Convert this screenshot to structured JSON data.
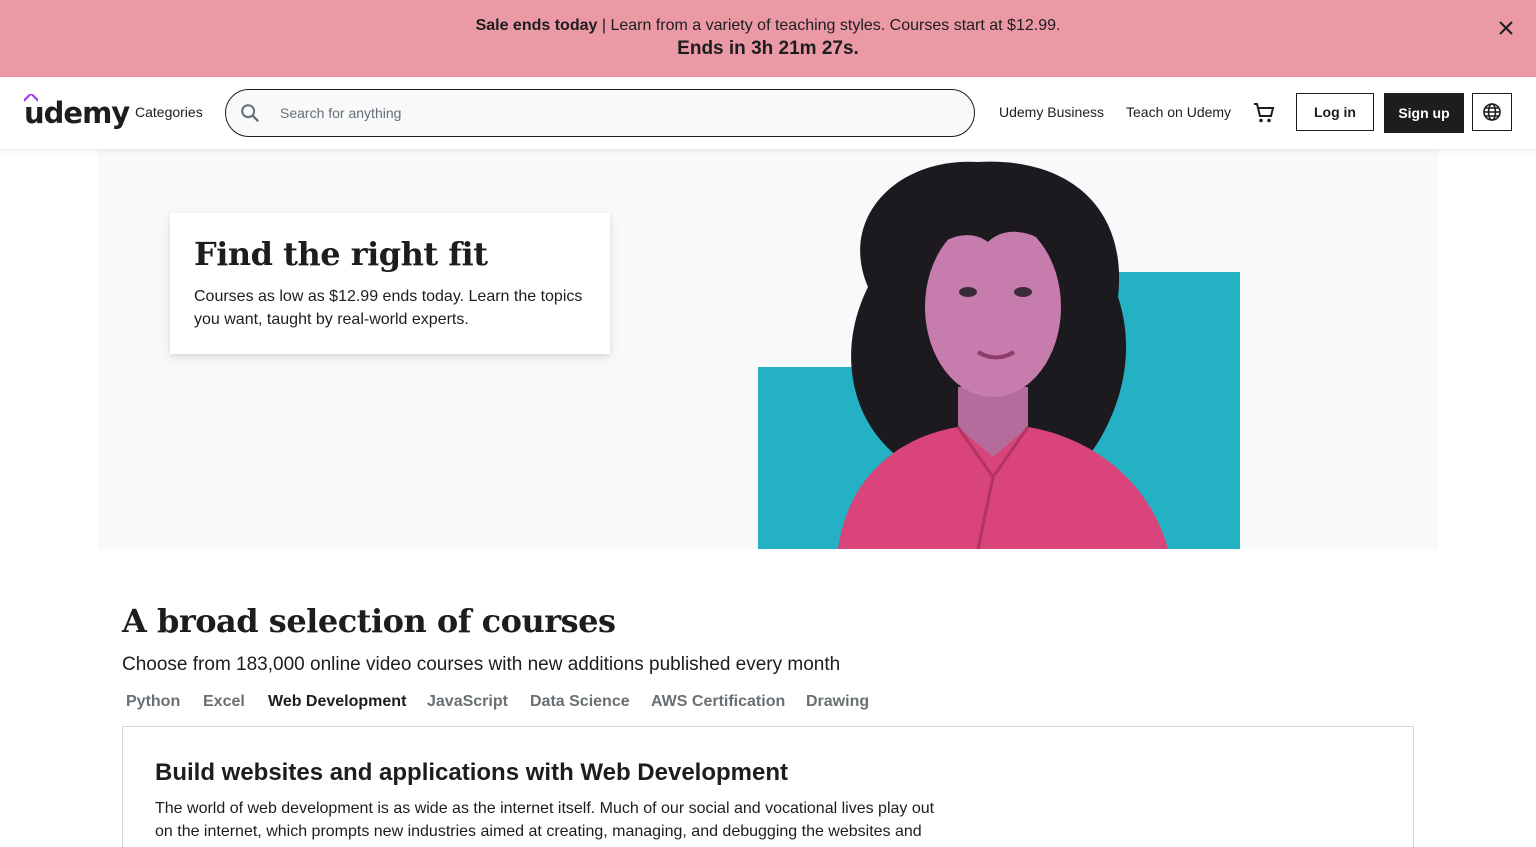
{
  "banner": {
    "sale_bold": "Sale ends today",
    "sale_text": " | Learn from a variety of teaching styles. Courses start at $12.99.",
    "countdown": "Ends in 3h 21m 27s.",
    "close_icon": "close-icon",
    "bg_color": "#ec99a6"
  },
  "header": {
    "logo_text": "udemy",
    "logo_accent_color": "#a435f0",
    "categories_label": "Categories",
    "search_placeholder": "Search for anything",
    "search_value": "",
    "udemy_business_label": "Udemy Business",
    "teach_label": "Teach on Udemy",
    "cart_icon": "cart-icon",
    "login_label": "Log in",
    "signup_label": "Sign up",
    "language_icon": "globe-icon"
  },
  "hero": {
    "title": "Find the right fit",
    "text": "Courses as low as $12.99 ends today. Learn the topics you want, taught by real-world experts.",
    "accent_color": "#23b1c3",
    "shirt_color": "#d9457a"
  },
  "courses": {
    "title": "A broad selection of courses",
    "subtitle": "Choose from 183,000 online video courses with new additions published every month",
    "tabs": [
      {
        "label": "Python",
        "active": false
      },
      {
        "label": "Excel",
        "active": false
      },
      {
        "label": "Web Development",
        "active": true
      },
      {
        "label": "JavaScript",
        "active": false
      },
      {
        "label": "Data Science",
        "active": false
      },
      {
        "label": "AWS Certification",
        "active": false
      },
      {
        "label": "Drawing",
        "active": false
      }
    ],
    "panel": {
      "title": "Build websites and applications with Web Development",
      "text": "The world of web development is as wide as the internet itself. Much of our social and vocational lives play out on the internet, which prompts new industries aimed at creating, managing, and debugging the websites and"
    }
  }
}
